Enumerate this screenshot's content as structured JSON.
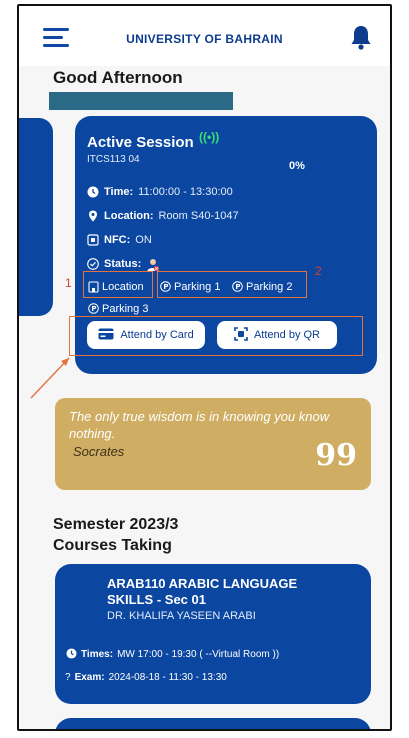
{
  "header": {
    "title": "UNIVERSITY OF BAHRAIN",
    "menu_icon": "hamburger-icon",
    "bell_icon": "bell-icon"
  },
  "greeting": "Good Afternoon",
  "session": {
    "title": "Active Session",
    "signal_icon": "((•))",
    "code": "ITCS113 04",
    "percent": "0%",
    "time_label": "Time:",
    "time_value": "11:00:00 - 13:30:00",
    "location_label": "Location:",
    "location_value": "Room S40-1047",
    "nfc_label": "NFC:",
    "nfc_value": "ON",
    "status_label": "Status:",
    "chip_location": "Location",
    "chip_parking1": "Parking 1",
    "chip_parking2": "Parking 2",
    "chip_parking3": "Parking 3",
    "btn_card": "Attend by Card",
    "btn_qr": "Attend by QR",
    "annot_1": "1",
    "annot_2": "2"
  },
  "quote": {
    "text": "The only true wisdom is in knowing you know nothing.",
    "author": "Socrates",
    "mark": "99"
  },
  "semester": {
    "line1": "Semester 2023/3",
    "line2": "Courses Taking"
  },
  "course": {
    "title": "ARAB110 ARABIC LANGUAGE SKILLS - Sec 01",
    "teacher": "DR. KHALIFA YASEEN ARABI",
    "times_label": "Times:",
    "times_value": "MW  17:00 - 19:30  ( --Virtual Room ))",
    "exam_label": "Exam:",
    "exam_value": "2024-08-18 - 11:30 - 13:30"
  },
  "colors": {
    "primary": "#0b46a0",
    "accent_green": "#37e07a",
    "quote_bg": "#cfae63",
    "annotation": "#e2733b"
  }
}
